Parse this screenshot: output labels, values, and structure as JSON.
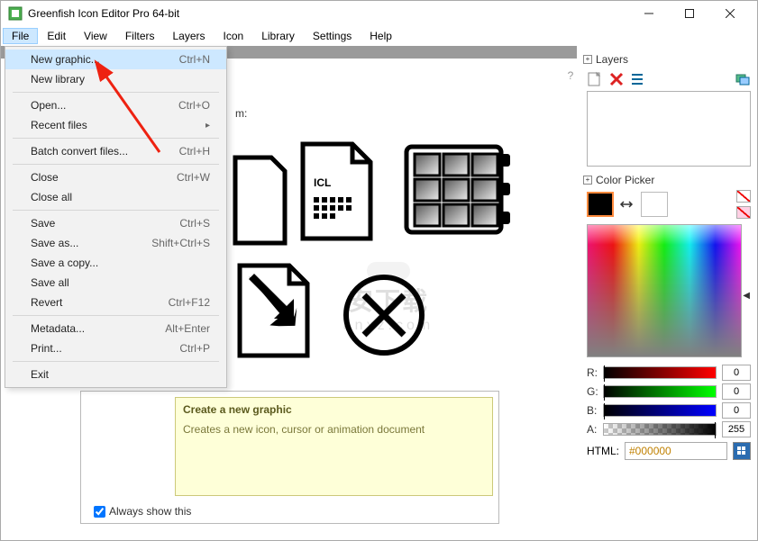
{
  "window": {
    "title": "Greenfish Icon Editor Pro 64-bit"
  },
  "menubar": [
    "File",
    "Edit",
    "View",
    "Filters",
    "Layers",
    "Icon",
    "Library",
    "Settings",
    "Help"
  ],
  "file_menu": [
    {
      "label": "New graphic...",
      "shortcut": "Ctrl+N",
      "kind": "item"
    },
    {
      "label": "New library",
      "shortcut": "",
      "kind": "item"
    },
    {
      "kind": "sep"
    },
    {
      "label": "Open...",
      "shortcut": "Ctrl+O",
      "kind": "item"
    },
    {
      "label": "Recent files",
      "shortcut": "",
      "kind": "sub"
    },
    {
      "kind": "sep"
    },
    {
      "label": "Batch convert files...",
      "shortcut": "Ctrl+H",
      "kind": "item"
    },
    {
      "kind": "sep"
    },
    {
      "label": "Close",
      "shortcut": "Ctrl+W",
      "kind": "item"
    },
    {
      "label": "Close all",
      "shortcut": "",
      "kind": "item"
    },
    {
      "kind": "sep"
    },
    {
      "label": "Save",
      "shortcut": "Ctrl+S",
      "kind": "item"
    },
    {
      "label": "Save as...",
      "shortcut": "Shift+Ctrl+S",
      "kind": "item"
    },
    {
      "label": "Save a copy...",
      "shortcut": "",
      "kind": "item"
    },
    {
      "label": "Save all",
      "shortcut": "",
      "kind": "item"
    },
    {
      "label": "Revert",
      "shortcut": "Ctrl+F12",
      "kind": "item"
    },
    {
      "kind": "sep"
    },
    {
      "label": "Metadata...",
      "shortcut": "Alt+Enter",
      "kind": "item"
    },
    {
      "label": "Print...",
      "shortcut": "Ctrl+P",
      "kind": "item"
    },
    {
      "kind": "sep"
    },
    {
      "label": "Exit",
      "shortcut": "",
      "kind": "item"
    }
  ],
  "help_tooltip": {
    "heading": "Create a new graphic",
    "desc": "Creates a new icon, cursor or animation document",
    "always": "Always show this"
  },
  "panels": {
    "layers_title": "Layers",
    "color_title": "Color Picker"
  },
  "color": {
    "r": "0",
    "g": "0",
    "b": "0",
    "a": "255",
    "html_label": "HTML:",
    "html_value": "#000000",
    "labels": {
      "r": "R:",
      "g": "G:",
      "b": "B:",
      "a": "A:"
    }
  },
  "docbar": {
    "help_icon": "?",
    "partial_text": "m:"
  },
  "watermark": {
    "main": "安下载",
    "sub": "anxz.com"
  },
  "central_icl": "ICL"
}
